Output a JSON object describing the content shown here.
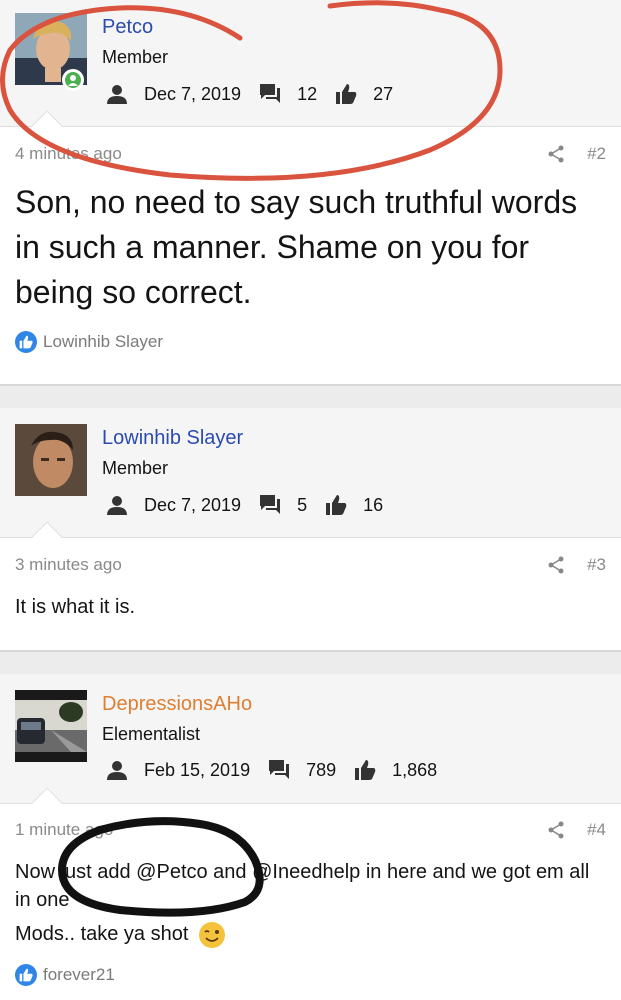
{
  "posts": [
    {
      "username": "Petco",
      "user_title": "Member",
      "join_date": "Dec 7, 2019",
      "messages": "12",
      "likes": "27",
      "time_ago": "4 minutes ago",
      "post_number": "#2",
      "body": "Son, no need to say such truthful words in such a manner. Shame on you for being so correct.",
      "reaction_user": "Lowinhib Slayer"
    },
    {
      "username": "Lowinhib Slayer",
      "user_title": "Member",
      "join_date": "Dec 7, 2019",
      "messages": "5",
      "likes": "16",
      "time_ago": "3 minutes ago",
      "post_number": "#3",
      "body": "It is what it is."
    },
    {
      "username": "DepressionsAHo",
      "user_title": "Elementalist",
      "join_date": "Feb 15, 2019",
      "messages": "789",
      "likes": "1,868",
      "time_ago": "1 minute ago",
      "post_number": "#4",
      "body_line1": "Now just add @Petco and @Ineedhelp in here and we got em all in one",
      "body_line2": "Mods.. take ya shot",
      "reaction_user": "forever21"
    }
  ],
  "colors": {
    "username_blue": "#2b4bb0",
    "username_orange": "#dd7f33",
    "annotation_red": "#d9533f",
    "annotation_black": "#111111"
  },
  "icons": [
    "user-icon",
    "messages-icon",
    "thumbs-up-icon",
    "share-icon",
    "like-reaction-icon",
    "wink-emoji-icon",
    "online-status-icon"
  ]
}
